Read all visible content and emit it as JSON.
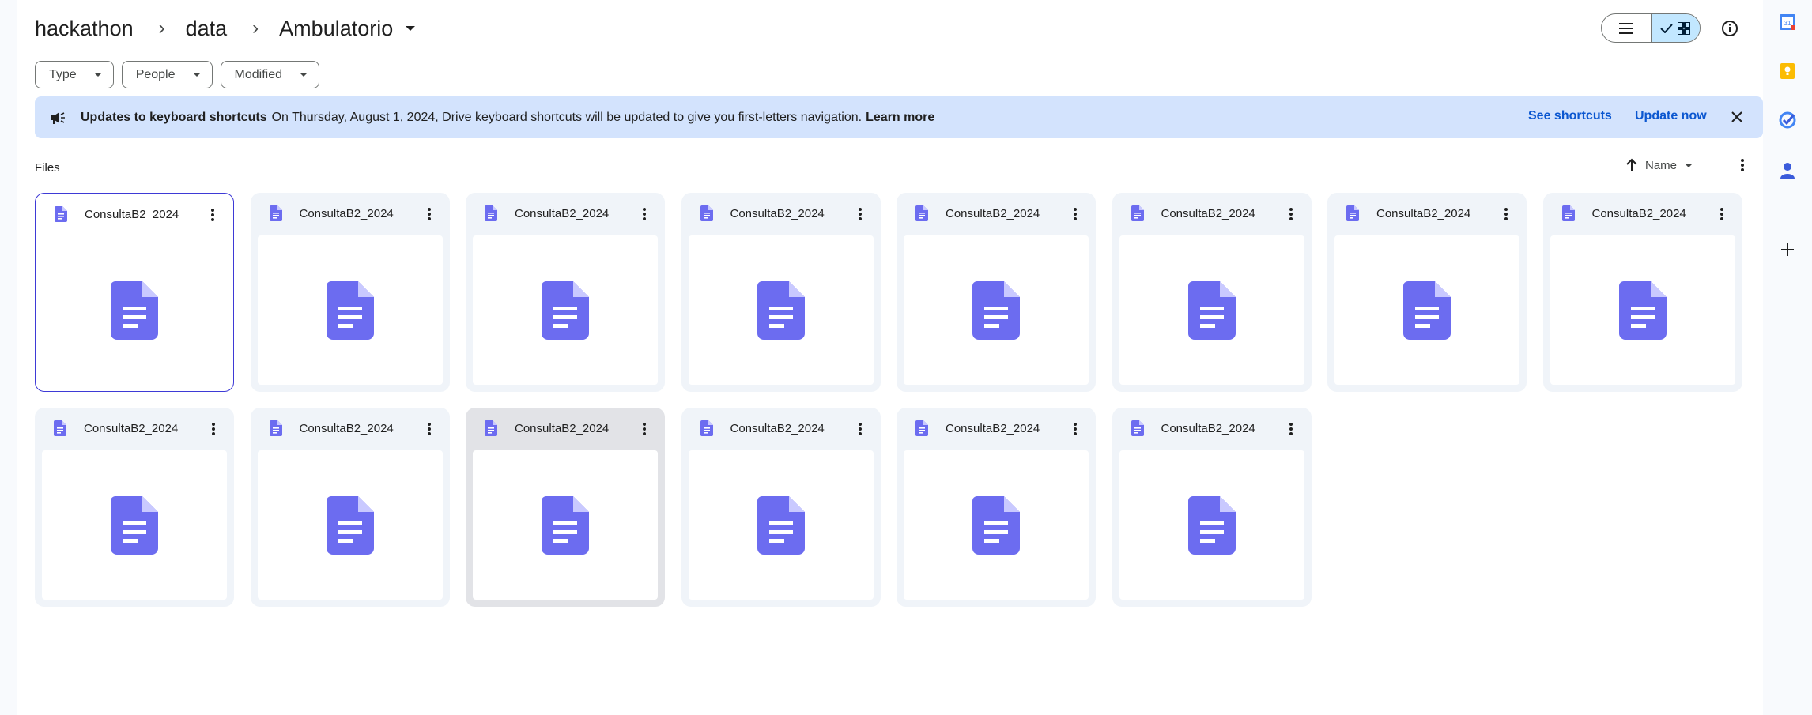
{
  "breadcrumb": {
    "items": [
      "hackathon",
      "data"
    ],
    "separator": "›",
    "current": "Ambulatorio"
  },
  "filters": [
    {
      "label": "Type"
    },
    {
      "label": "People"
    },
    {
      "label": "Modified"
    }
  ],
  "banner": {
    "title": "Updates to keyboard shortcuts",
    "text": "On Thursday, August 1, 2024, Drive keyboard shortcuts will be updated to give you first-letters navigation.",
    "link": "Learn more",
    "see_shortcuts": "See shortcuts",
    "update_now": "Update now"
  },
  "files_header": {
    "label": "Files",
    "sort_label": "Name"
  },
  "files": [
    {
      "name": "ConsultaB2_2024",
      "state": "selected"
    },
    {
      "name": "ConsultaB2_2024",
      "state": "normal"
    },
    {
      "name": "ConsultaB2_2024",
      "state": "normal"
    },
    {
      "name": "ConsultaB2_2024",
      "state": "normal"
    },
    {
      "name": "ConsultaB2_2024",
      "state": "normal"
    },
    {
      "name": "ConsultaB2_2024",
      "state": "normal"
    },
    {
      "name": "ConsultaB2_2024",
      "state": "normal"
    },
    {
      "name": "ConsultaB2_2024",
      "state": "normal"
    },
    {
      "name": "ConsultaB2_2024",
      "state": "normal"
    },
    {
      "name": "ConsultaB2_2024",
      "state": "normal"
    },
    {
      "name": "ConsultaB2_2024",
      "state": "hovered"
    },
    {
      "name": "ConsultaB2_2024",
      "state": "normal"
    },
    {
      "name": "ConsultaB2_2024",
      "state": "normal"
    },
    {
      "name": "ConsultaB2_2024",
      "state": "normal"
    }
  ],
  "colors": {
    "doc_icon": "#6c6cf0",
    "accent": "#0b57d0",
    "banner_bg": "#d3e3fd",
    "toggle_active": "#c2e7ff"
  },
  "right_bar": {
    "icons": [
      "calendar-icon",
      "keep-icon",
      "tasks-icon",
      "contacts-icon",
      "add-icon"
    ],
    "calendar_day": "31"
  }
}
